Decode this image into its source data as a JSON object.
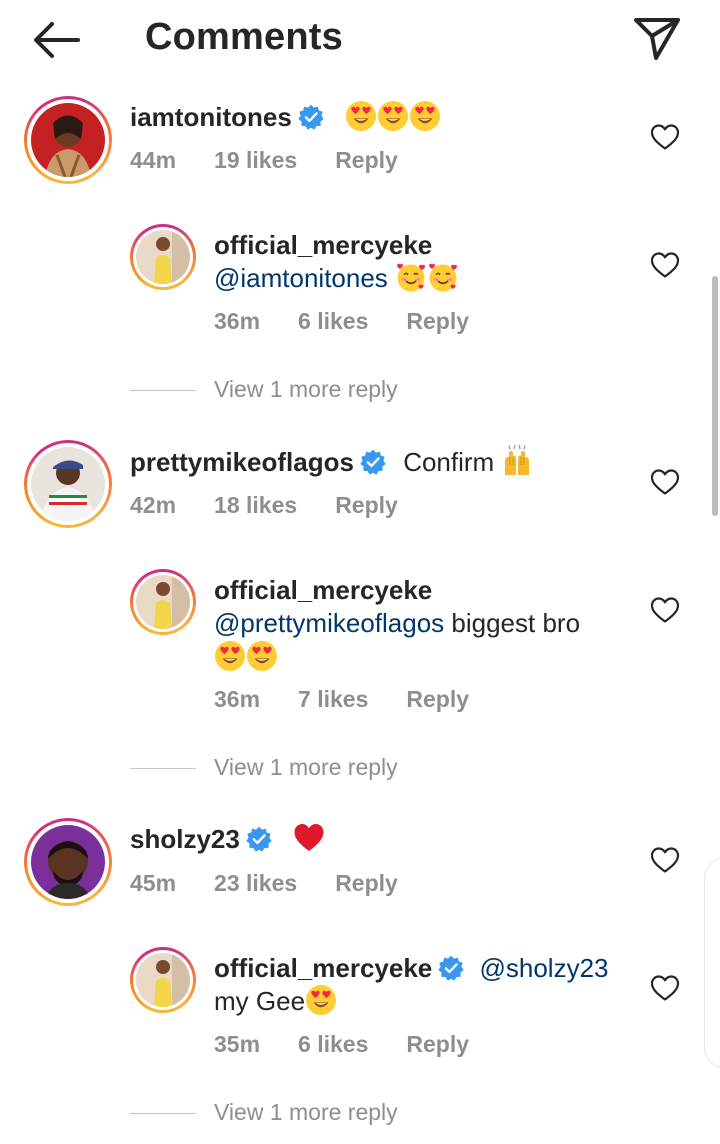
{
  "header": {
    "title": "Comments",
    "back_icon": "arrow-left-icon",
    "share_icon": "paper-plane-icon"
  },
  "colors": {
    "text": "#262626",
    "meta": "#8e8e8e",
    "mention": "#00376b",
    "verified": "#3897f0",
    "heart_emoji": "#e0182d"
  },
  "comments": [
    {
      "username": "iamtonitones",
      "verified": true,
      "text": "",
      "emojis": [
        "heart-eyes-emoji",
        "heart-eyes-emoji",
        "heart-eyes-emoji"
      ],
      "time": "44m",
      "likes": "19 likes",
      "reply": "Reply",
      "replies": [
        {
          "username": "official_mercyeke",
          "verified": false,
          "mention": "@iamtonitones",
          "text": "",
          "emojis": [
            "smiling-face-with-hearts-emoji",
            "smiling-face-with-hearts-emoji"
          ],
          "time": "36m",
          "likes": "6 likes",
          "reply": "Reply"
        }
      ],
      "view_more": "View 1 more reply"
    },
    {
      "username": "prettymikeoflagos",
      "verified": true,
      "text": "Confirm",
      "emojis": [
        "raising-hands-emoji"
      ],
      "time": "42m",
      "likes": "18 likes",
      "reply": "Reply",
      "replies": [
        {
          "username": "official_mercyeke",
          "verified": false,
          "mention": "@prettymikeoflagos",
          "text": "biggest bro",
          "emojis": [
            "heart-eyes-emoji",
            "heart-eyes-emoji"
          ],
          "time": "36m",
          "likes": "7 likes",
          "reply": "Reply"
        }
      ],
      "view_more": "View 1 more reply"
    },
    {
      "username": "sholzy23",
      "verified": true,
      "text": "",
      "emojis": [
        "red-heart-emoji"
      ],
      "time": "45m",
      "likes": "23 likes",
      "reply": "Reply",
      "replies": [
        {
          "username": "official_mercyeke",
          "verified": true,
          "mention": "@sholzy23",
          "text": "my Gee",
          "emojis": [
            "heart-eyes-emoji"
          ],
          "time": "35m",
          "likes": "6 likes",
          "reply": "Reply"
        }
      ],
      "view_more": "View 1 more reply"
    }
  ]
}
